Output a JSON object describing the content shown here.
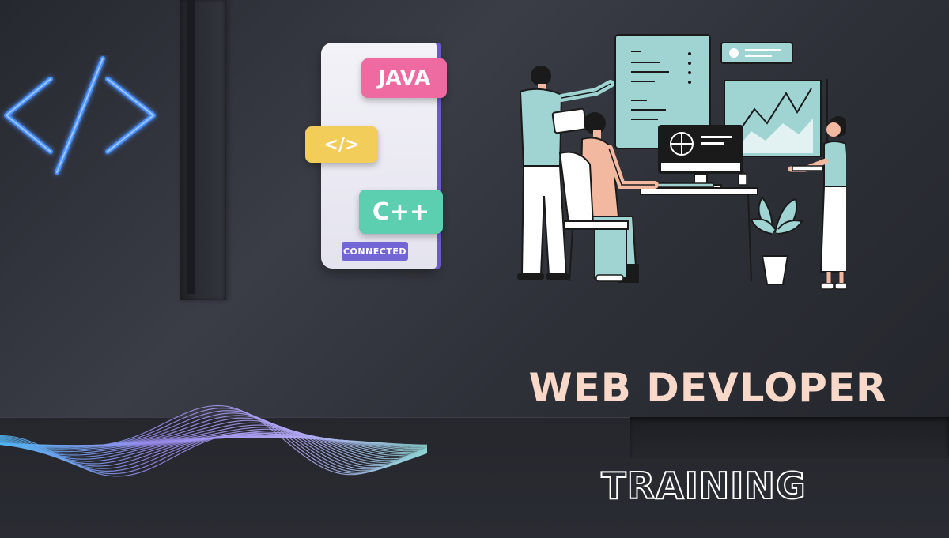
{
  "tags": {
    "java": "JAVA",
    "code": "</>",
    "cpp": "C++",
    "connected": "CONNECTED"
  },
  "headline": {
    "title": "WEB DEVLOPER",
    "subtitle": "TRAINING"
  },
  "icons": {
    "code_symbol": "code-brackets-icon",
    "illustration": "developers-team-illustration",
    "wave": "line-wave-graphic"
  },
  "colors": {
    "background": "#2e3038",
    "neon_blue": "#4a90ff",
    "java": "#ef6aa0",
    "code": "#f2cd5a",
    "cpp": "#5ccfb0",
    "connected": "#7265d6",
    "title": "#f8d8c8",
    "teal": "#9fd4d2"
  }
}
